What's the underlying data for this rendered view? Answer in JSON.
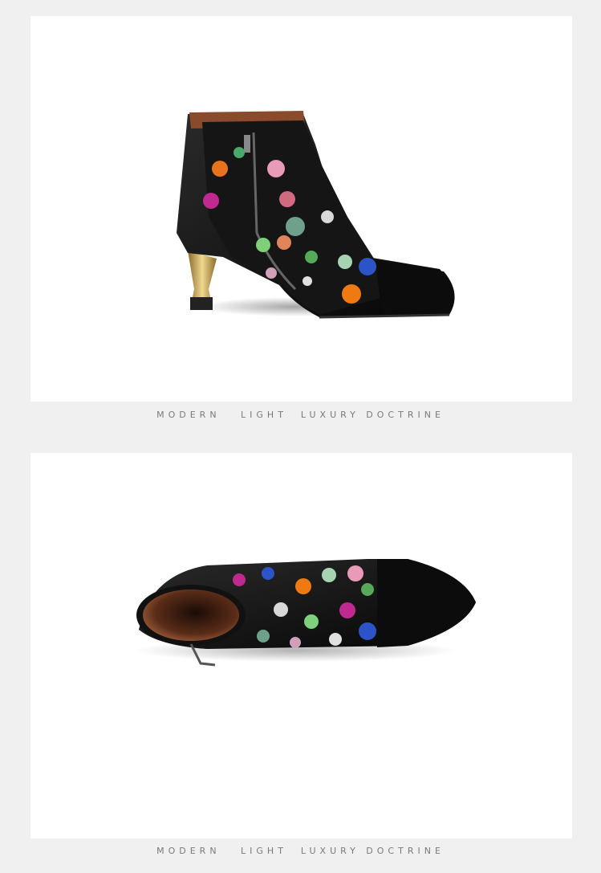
{
  "sections": [
    {
      "image": "ankle-boot-side-view",
      "tagline": "MODERN   LIGHT  LUXURY DOCTRINE"
    },
    {
      "image": "ankle-boot-top-view",
      "tagline": "MODERN   LIGHT  LUXURY DOCTRINE"
    }
  ],
  "colors": {
    "page_background": "#f0f0f0",
    "panel_background": "#ffffff",
    "tagline_text": "#7a7a7a",
    "leather": "#111111",
    "lining": "#8a4a2c",
    "heel_metal": "#c9a54a"
  }
}
